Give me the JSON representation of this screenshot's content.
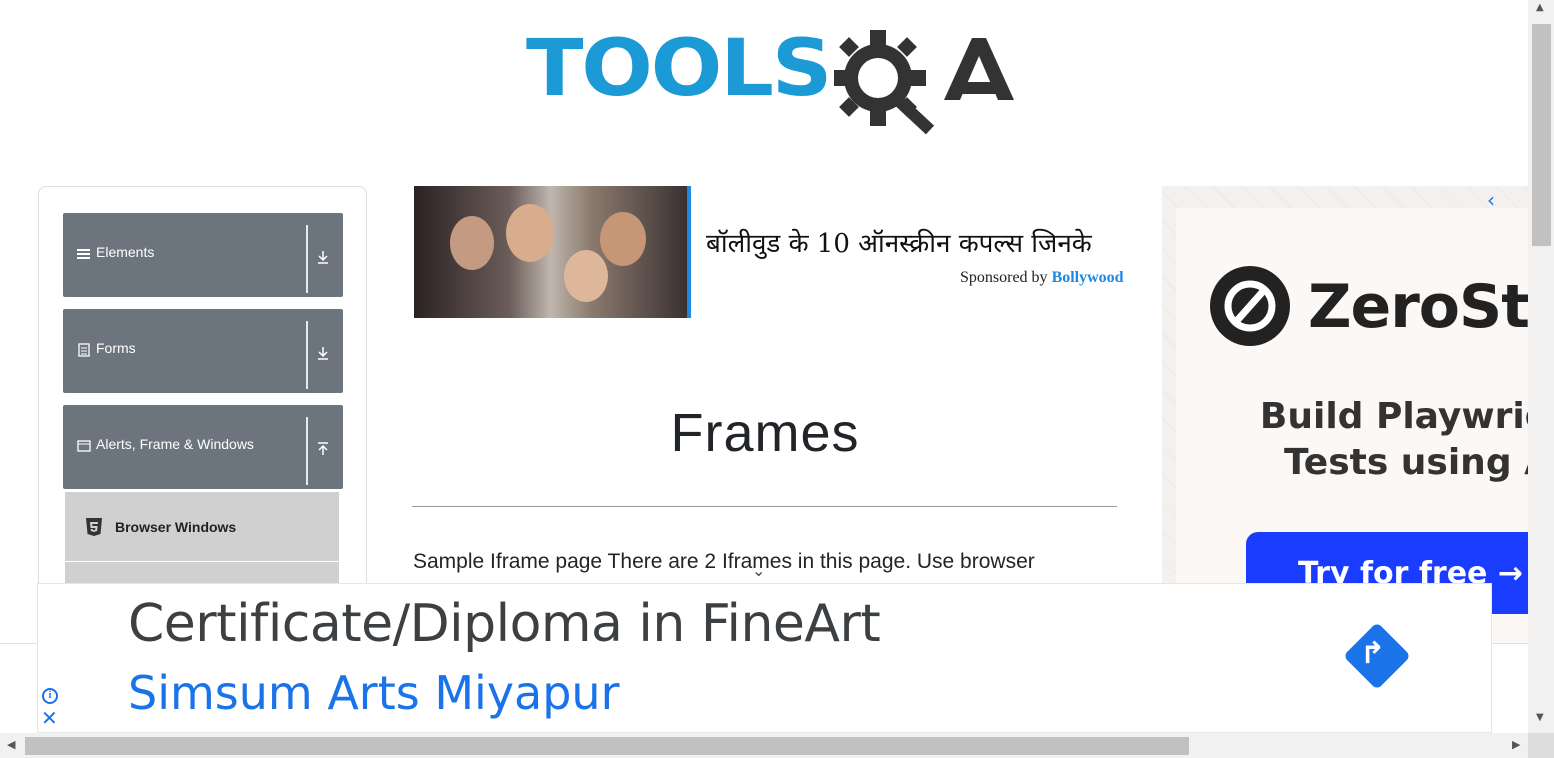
{
  "logo": {
    "part1": "TOOLS",
    "part2": "QA",
    "color_primary": "#1b9ad6",
    "color_secondary": "#333333"
  },
  "sidebar": {
    "groups": [
      {
        "label": "Elements",
        "icon": "hamburger-icon",
        "arrow": "download-icon"
      },
      {
        "label": "Forms",
        "icon": "document-icon",
        "arrow": "download-icon"
      },
      {
        "label": "Alerts, Frame & Windows",
        "icon": "window-icon",
        "arrow": "upload-icon"
      }
    ],
    "sub_items": [
      {
        "label": "Browser Windows",
        "icon": "html5-icon"
      }
    ]
  },
  "sponsored": {
    "headline": "बॉलीवुड के 10 ऑनस्क्रीन कपल्स जिनके",
    "by_prefix": "Sponsored by",
    "brand": "Bollywood"
  },
  "main": {
    "title": "Frames",
    "body": "Sample Iframe page There are 2 Iframes in this page. Use browser"
  },
  "ad_right": {
    "brand": "ZeroSte",
    "headline_line1": "Build Playwrigh",
    "headline_line2": "Tests using A",
    "cta": "Try for free →",
    "chevron": "‹"
  },
  "banner": {
    "title": "Certificate/Diploma in FineArt",
    "subtitle": "Simsum Arts Miyapur",
    "info_glyph": "i",
    "close_glyph": "✕",
    "go_glyph": "↱"
  },
  "colors": {
    "sidebar_group_bg": "#6c757d",
    "link_blue": "#1a73e8",
    "cta_blue": "#1a3cff"
  }
}
